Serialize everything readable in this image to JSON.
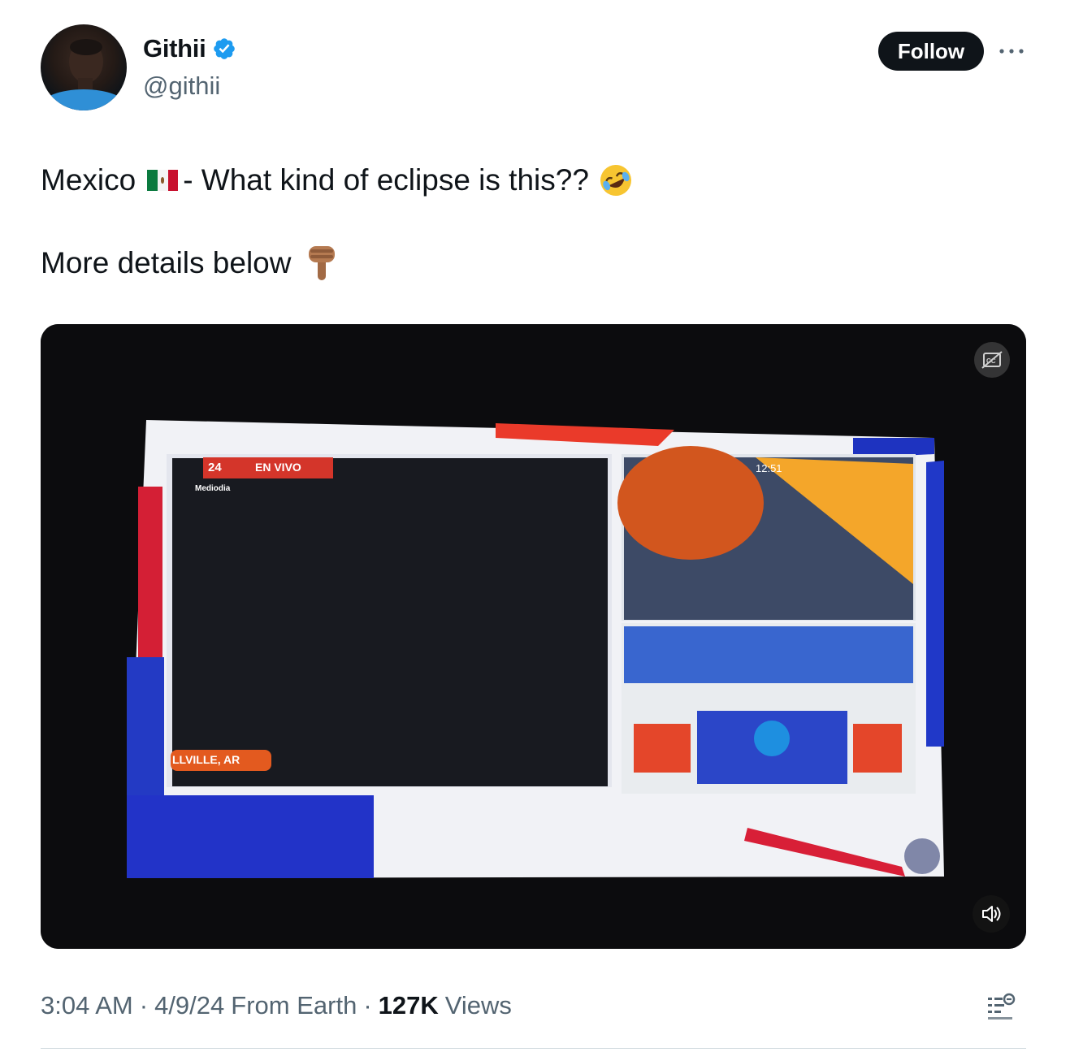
{
  "author": {
    "display_name": "Githii",
    "handle": "@githii",
    "verified_icon": "verified-badge-icon"
  },
  "follow_label": "Follow",
  "more_icon": "more-dots-icon",
  "tweet": {
    "line1_prefix": "Mexico",
    "line1_flag_icon": "mexico-flag-icon",
    "line1_text": "- What kind of eclipse is this??",
    "line1_emoji_icon": "rolling-on-floor-laughing-icon",
    "line2_text": "More details below",
    "line2_emoji_icon": "backhand-index-pointing-down-icon"
  },
  "video": {
    "overlay_badge": "EN VIVO",
    "overlay_sub": "Mediodia",
    "overlay_num": "24",
    "location_strip": "LLVILLE, AR",
    "clock": "12:51",
    "cc_icon": "captions-icon",
    "mute_icon": "volume-icon"
  },
  "meta": {
    "time": "3:04 AM",
    "sep1": "·",
    "date": "4/9/24",
    "source": "From Earth",
    "sep2": "·",
    "views_count": "127K",
    "views_label": "Views",
    "analytics_icon": "analytics-icon"
  },
  "colors": {
    "text": "#0f1419",
    "secondary": "#536471",
    "verified": "#1d9bf0",
    "follow_bg": "#0f1419"
  }
}
